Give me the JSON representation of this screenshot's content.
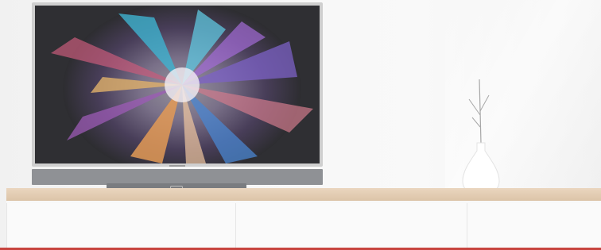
{
  "scene": {
    "type": "product-photo",
    "subject": "television-on-sideboard",
    "colors": {
      "wall": "#f3f3f3",
      "tv_frame": "#cfcfcf",
      "soundbar": "#8f9195",
      "sideboard_top": "#dcc4a8",
      "sideboard_body": "#f8f8f8",
      "accent_line": "#c7443f"
    },
    "objects": [
      "television",
      "soundbar",
      "tv-stand",
      "vase-with-branches",
      "sideboard"
    ]
  }
}
